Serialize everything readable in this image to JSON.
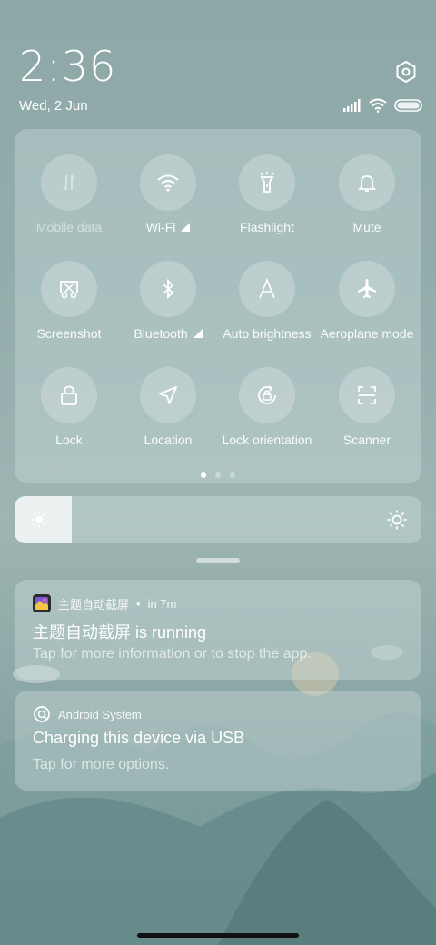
{
  "status": {
    "time": "2:36",
    "date": "Wed, 2 Jun",
    "icons": [
      "signal-icon",
      "wifi-icon",
      "battery-icon"
    ]
  },
  "quick_settings": {
    "tiles": [
      {
        "label": "Mobile data",
        "icon": "mobile-data-icon",
        "enabled": false
      },
      {
        "label": "Wi-Fi",
        "icon": "wifi-icon",
        "has_expand": true
      },
      {
        "label": "Flashlight",
        "icon": "flashlight-icon"
      },
      {
        "label": "Mute",
        "icon": "bell-icon"
      },
      {
        "label": "Screenshot",
        "icon": "screenshot-icon"
      },
      {
        "label": "Bluetooth",
        "icon": "bluetooth-icon",
        "has_expand": true
      },
      {
        "label": "Auto brightness",
        "icon": "auto-brightness-icon"
      },
      {
        "label": "Aeroplane mode",
        "icon": "airplane-icon"
      },
      {
        "label": "Lock",
        "icon": "lock-icon"
      },
      {
        "label": "Location",
        "icon": "location-icon"
      },
      {
        "label": "Lock orientation",
        "icon": "rotation-lock-icon"
      },
      {
        "label": "Scanner",
        "icon": "scanner-icon"
      }
    ],
    "page_count": 3,
    "active_page": 1
  },
  "brightness": {
    "level": 0.14
  },
  "notifications": [
    {
      "app": "主题自动截屏",
      "time": "in 7m",
      "title": "主题自动截屏 is running",
      "body": "Tap for more information or to stop the app."
    },
    {
      "app": "Android System",
      "title": "Charging this device via USB",
      "body": "Tap for more options."
    }
  ],
  "colors": {
    "panel": "#b9cccc",
    "text": "#ffffff"
  }
}
